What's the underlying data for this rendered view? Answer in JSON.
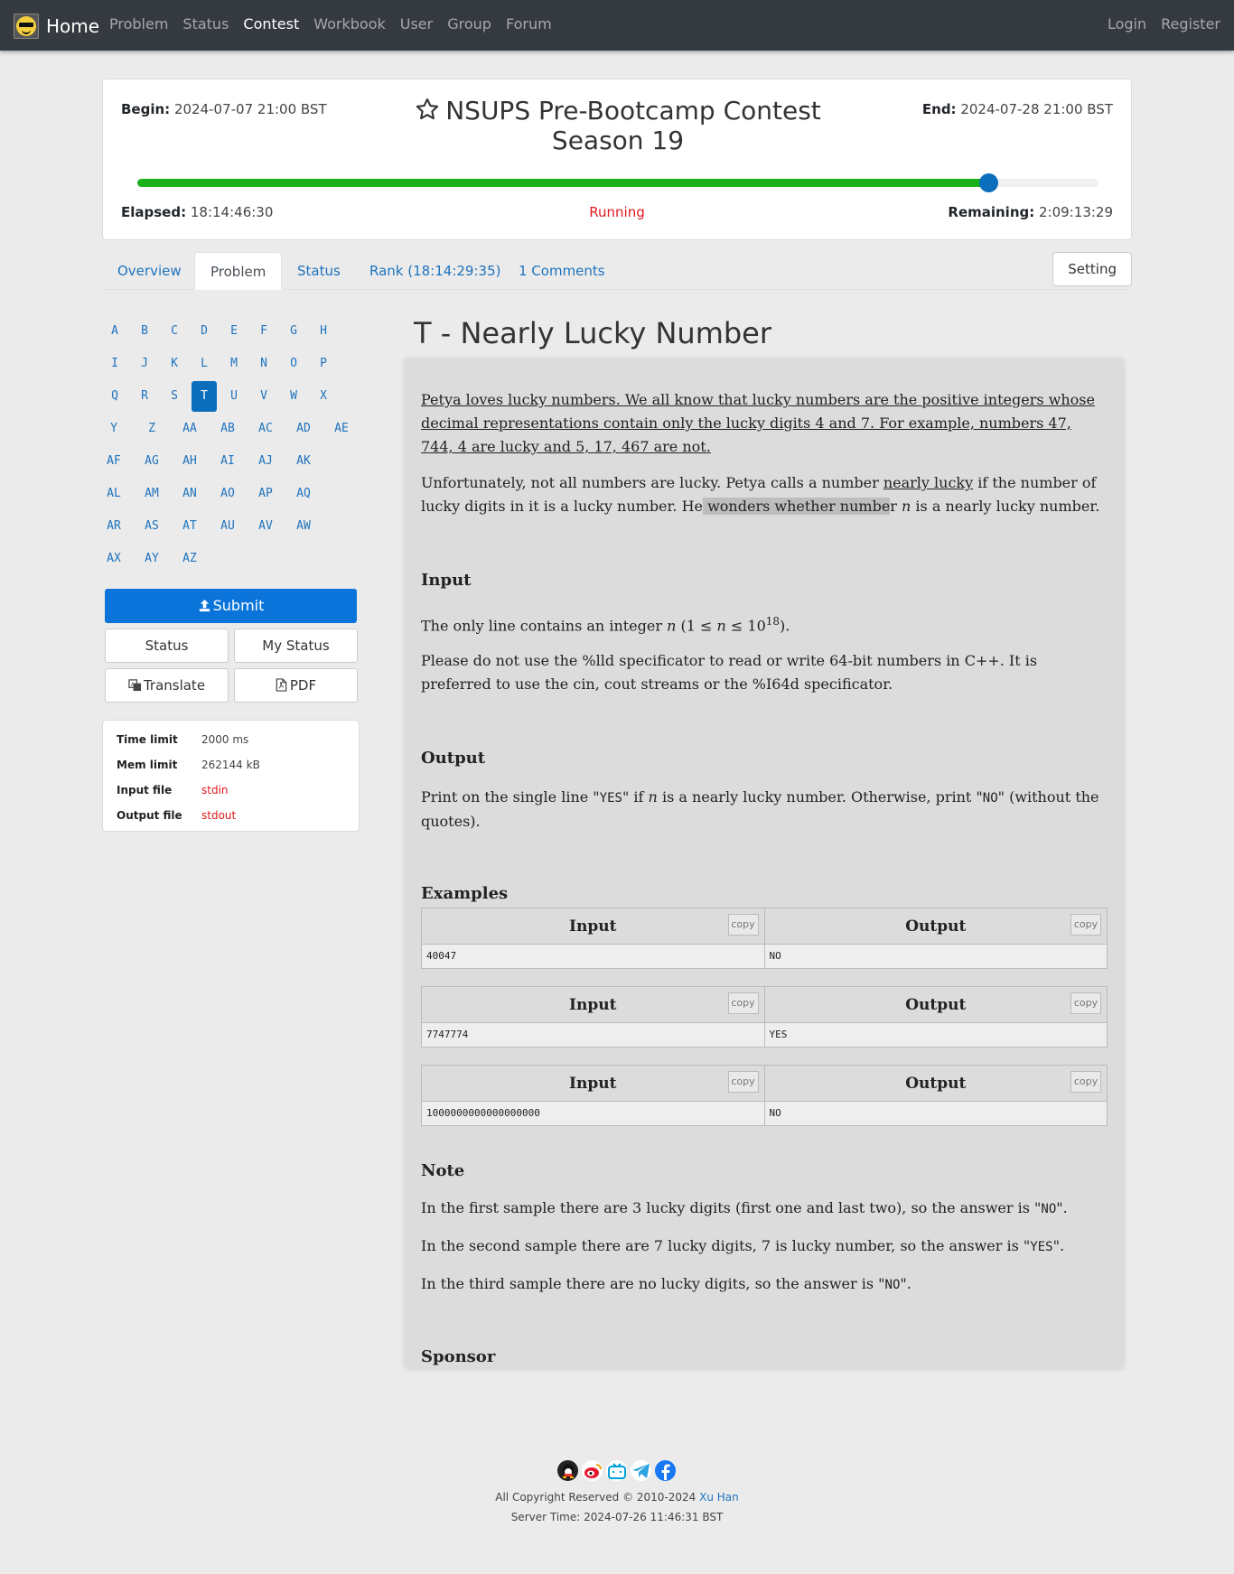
{
  "nav": {
    "brand": "Home",
    "left": [
      "Problem",
      "Status",
      "Contest",
      "Workbook",
      "User",
      "Group",
      "Forum"
    ],
    "active": "Contest",
    "right": [
      "Login",
      "Register"
    ]
  },
  "contest": {
    "begin_label": "Begin:",
    "begin": "2024-07-07 21:00 BST",
    "end_label": "End:",
    "end": "2024-07-28 21:00 BST",
    "title": "NSUPS Pre-Bootcamp Contest Season 19",
    "progress_fraction": 0.885,
    "elapsed_label": "Elapsed:",
    "elapsed": "18:14:46:30",
    "status": "Running",
    "remaining_label": "Remaining:",
    "remaining": "2:09:13:29",
    "colors": {
      "progress": "#19b019",
      "knob": "#0a6ebd",
      "status": "#e0181f"
    }
  },
  "tabs": {
    "overview": "Overview",
    "problem": "Problem",
    "status": "Status",
    "rank": "Rank (18:14:29:35)",
    "comments": "1 Comments",
    "setting": "Setting"
  },
  "problem_letters": [
    [
      "A",
      "B",
      "C",
      "D",
      "E",
      "F",
      "G",
      "H"
    ],
    [
      "I",
      "J",
      "K",
      "L",
      "M",
      "N",
      "O",
      "P"
    ],
    [
      "Q",
      "R",
      "S",
      "T",
      "U",
      "V",
      "W",
      "X"
    ],
    [
      "Y",
      "Z",
      "AA",
      "AB",
      "AC",
      "AD",
      "AE"
    ],
    [
      "AF",
      "AG",
      "AH",
      "AI",
      "AJ",
      "AK"
    ],
    [
      "AL",
      "AM",
      "AN",
      "AO",
      "AP",
      "AQ"
    ],
    [
      "AR",
      "AS",
      "AT",
      "AU",
      "AV",
      "AW"
    ],
    [
      "AX",
      "AY",
      "AZ"
    ]
  ],
  "active_letter": "T",
  "sidebar": {
    "submit": "Submit",
    "status": "Status",
    "my_status": "My Status",
    "translate": "Translate",
    "pdf": "PDF",
    "limits": {
      "time_limit_label": "Time limit",
      "time_limit": "2000 ms",
      "mem_limit_label": "Mem limit",
      "mem_limit": "262144 kB",
      "input_file_label": "Input file",
      "input_file": "stdin",
      "output_file_label": "Output file",
      "output_file": "stdout"
    }
  },
  "problem": {
    "title": "T - Nearly Lucky Number",
    "legend_p1": "Petya loves lucky numbers. We all know that lucky numbers are the positive integers whose decimal representations contain only the lucky digits 4 and 7. For example, numbers 47, 744, 4 are lucky and 5, 17, 467 are not.",
    "legend_p2_a": "Unfortunately, not all numbers are lucky. Petya calls a number ",
    "legend_p2_u": "nearly lucky",
    "legend_p2_b": " if the number of lucky digits in it is a lucky number. He",
    "legend_p2_hl": " wonders whether numbe",
    "legend_p2_c": "r ",
    "legend_p2_n": "n",
    "legend_p2_d": " is a nearly lucky number.",
    "input_h": "Input",
    "input_p1_a": "The only line contains an integer ",
    "input_p1_math": "n",
    "input_p1_b": " (1 ≤ ",
    "input_p1_math2": "n",
    "input_p1_c": " ≤ 10",
    "input_p1_sup": "18",
    "input_p1_d": ").",
    "input_p2": "Please do not use the %lld specificator to read or write 64-bit numbers in C++. It is preferred to use the cin, cout streams or the %I64d specificator.",
    "output_h": "Output",
    "output_a": "Print on the single line \"",
    "output_yes": "YES",
    "output_b": "\" if ",
    "output_n": "n",
    "output_c": " is a nearly lucky number. Otherwise, print \"",
    "output_no": "NO",
    "output_d": "\" (without the quotes).",
    "examples_h": "Examples",
    "ex_input_h": "Input",
    "ex_output_h": "Output",
    "copy": "copy",
    "examples": [
      {
        "input": "40047",
        "output": "NO"
      },
      {
        "input": "7747774",
        "output": "YES"
      },
      {
        "input": "1000000000000000000",
        "output": "NO"
      }
    ],
    "note_h": "Note",
    "note1_a": "In the first sample there are 3 lucky digits (first one and last two), so the answer is \"",
    "note1_code": "NO",
    "note1_b": "\".",
    "note2_a": "In the second sample there are 7 lucky digits, 7 is lucky number, so the answer is \"",
    "note2_code": "YES",
    "note2_b": "\".",
    "note3_a": "In the third sample there are no lucky digits, so the answer is \"",
    "note3_code": "NO",
    "note3_b": "\".",
    "sponsor_h": "Sponsor"
  },
  "footer": {
    "icons": [
      "qq-icon",
      "weibo-icon",
      "bilibili-icon",
      "telegram-icon",
      "facebook-icon"
    ],
    "copyright": "All Copyright Reserved © 2010-2024 ",
    "author": "Xu Han",
    "server_time": "Server Time: 2024-07-26 11:46:31 BST"
  }
}
